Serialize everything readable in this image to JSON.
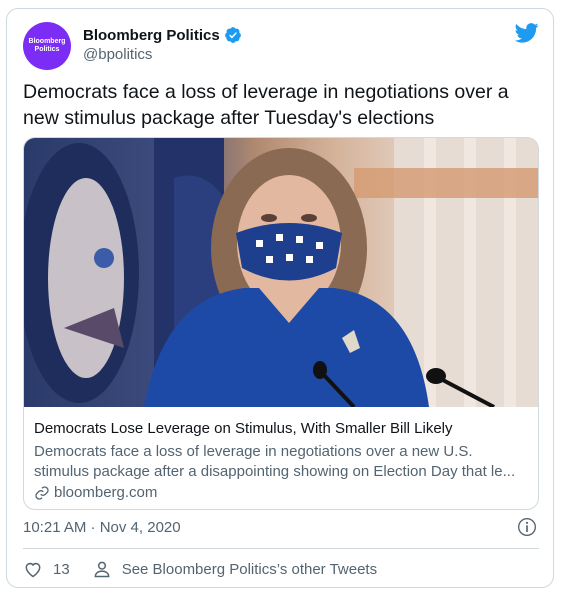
{
  "account": {
    "avatar_text_line1": "Bloomberg",
    "avatar_text_line2": "Politics",
    "name": "Bloomberg Politics",
    "handle": "@bpolitics"
  },
  "tweet": {
    "text": "Democrats face a loss of leverage in negotiations over a new stimulus package after Tuesday's elections",
    "timestamp": "10:21 AM · Nov 4, 2020"
  },
  "card": {
    "headline": "Democrats Lose Leverage on Stimulus, With Smaller Bill Likely",
    "description_line1": "Democrats face a loss of leverage in negotiations over a new U.S.",
    "description_line2": "stimulus package after a disappointing showing on Election Day that le...",
    "domain": "bloomberg.com"
  },
  "actions": {
    "like_count": "13",
    "profile_link": "See Bloomberg Politics’s other Tweets"
  },
  "colors": {
    "avatar": "#7b2cf5",
    "verified": "#1d9bf0",
    "twitter_blue": "#1d9bf0",
    "border": "#cfd9de",
    "secondary_text": "#536471"
  },
  "icons": [
    "verified-badge-icon",
    "twitter-bird-icon",
    "link-icon",
    "info-icon",
    "heart-icon",
    "person-icon"
  ]
}
